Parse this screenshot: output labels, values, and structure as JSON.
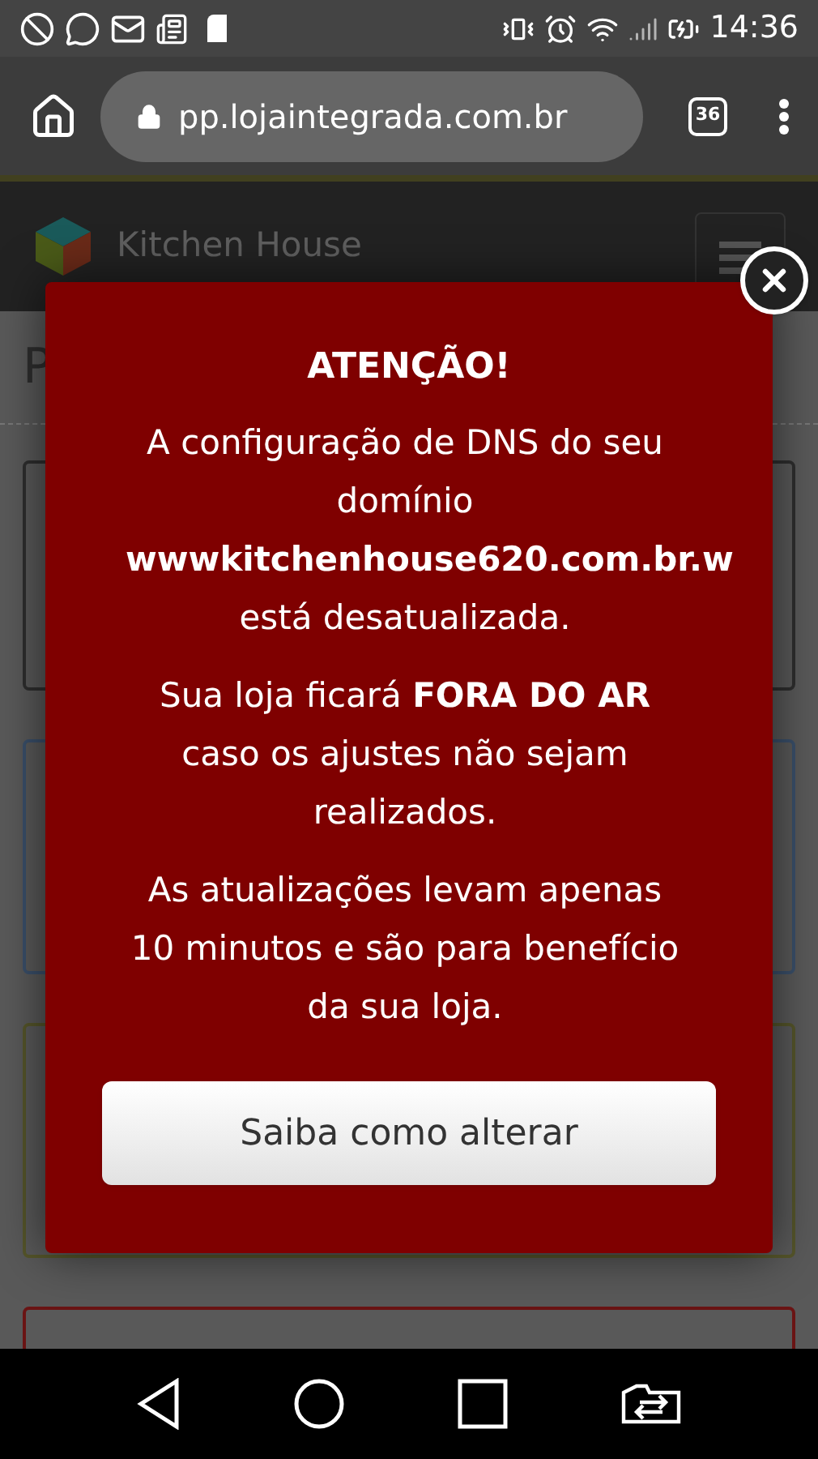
{
  "status_bar": {
    "time": "14:36"
  },
  "browser": {
    "url": "pp.lojaintegrada.com.br",
    "tab_count": "36"
  },
  "site_header": {
    "name": "Kitchen House"
  },
  "page": {
    "heading": "P"
  },
  "modal": {
    "title": "ATENÇÃO!",
    "paragraphs": [
      "A configuração de DNS do seu domínio **wwwkitchenhouse620.com.br.w** está desatualizada.",
      "Sua loja ficará **FORA DO AR** caso os ajustes não sejam realizados.",
      "As atualizações levam apenas 10 minutos e são para benefício da sua loja."
    ],
    "button": "Saiba como alterar"
  }
}
